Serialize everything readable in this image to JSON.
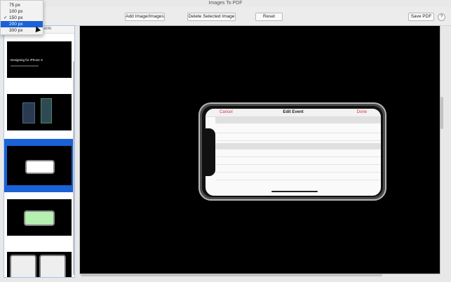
{
  "window": {
    "title": "Images To PDF"
  },
  "toolbar": {
    "add_label": "Add Image/Images",
    "delete_label": "Delete Selected Image",
    "reset_label": "Reset",
    "save_label": "Save PDF",
    "help_label": "?"
  },
  "size_menu": {
    "options": [
      "75 px",
      "100 px",
      "150 px",
      "200 px",
      "300 px"
    ],
    "checked": "150 px",
    "highlighted": "200 px",
    "check_mark": "✓"
  },
  "sidebar": {
    "header_text": "able",
    "thumb1_title": "Designing for iPhone X"
  },
  "preview": {
    "nav_cancel": "Cancel",
    "nav_title": "Edit Event",
    "nav_done": "Done"
  },
  "colors": {
    "accent": "#1a62d6",
    "nav_action": "#d2333f"
  }
}
